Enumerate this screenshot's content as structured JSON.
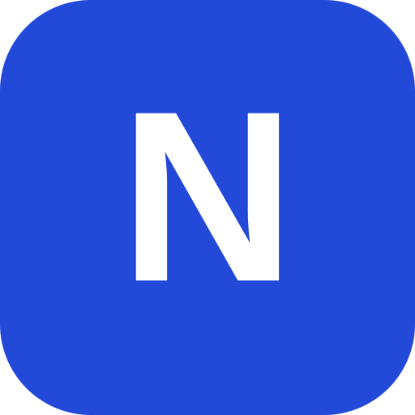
{
  "app_icon": {
    "letter": "N",
    "icon_name": "letter-n-app-icon",
    "background_color": "#2349d9",
    "letter_color": "#ffffff"
  }
}
